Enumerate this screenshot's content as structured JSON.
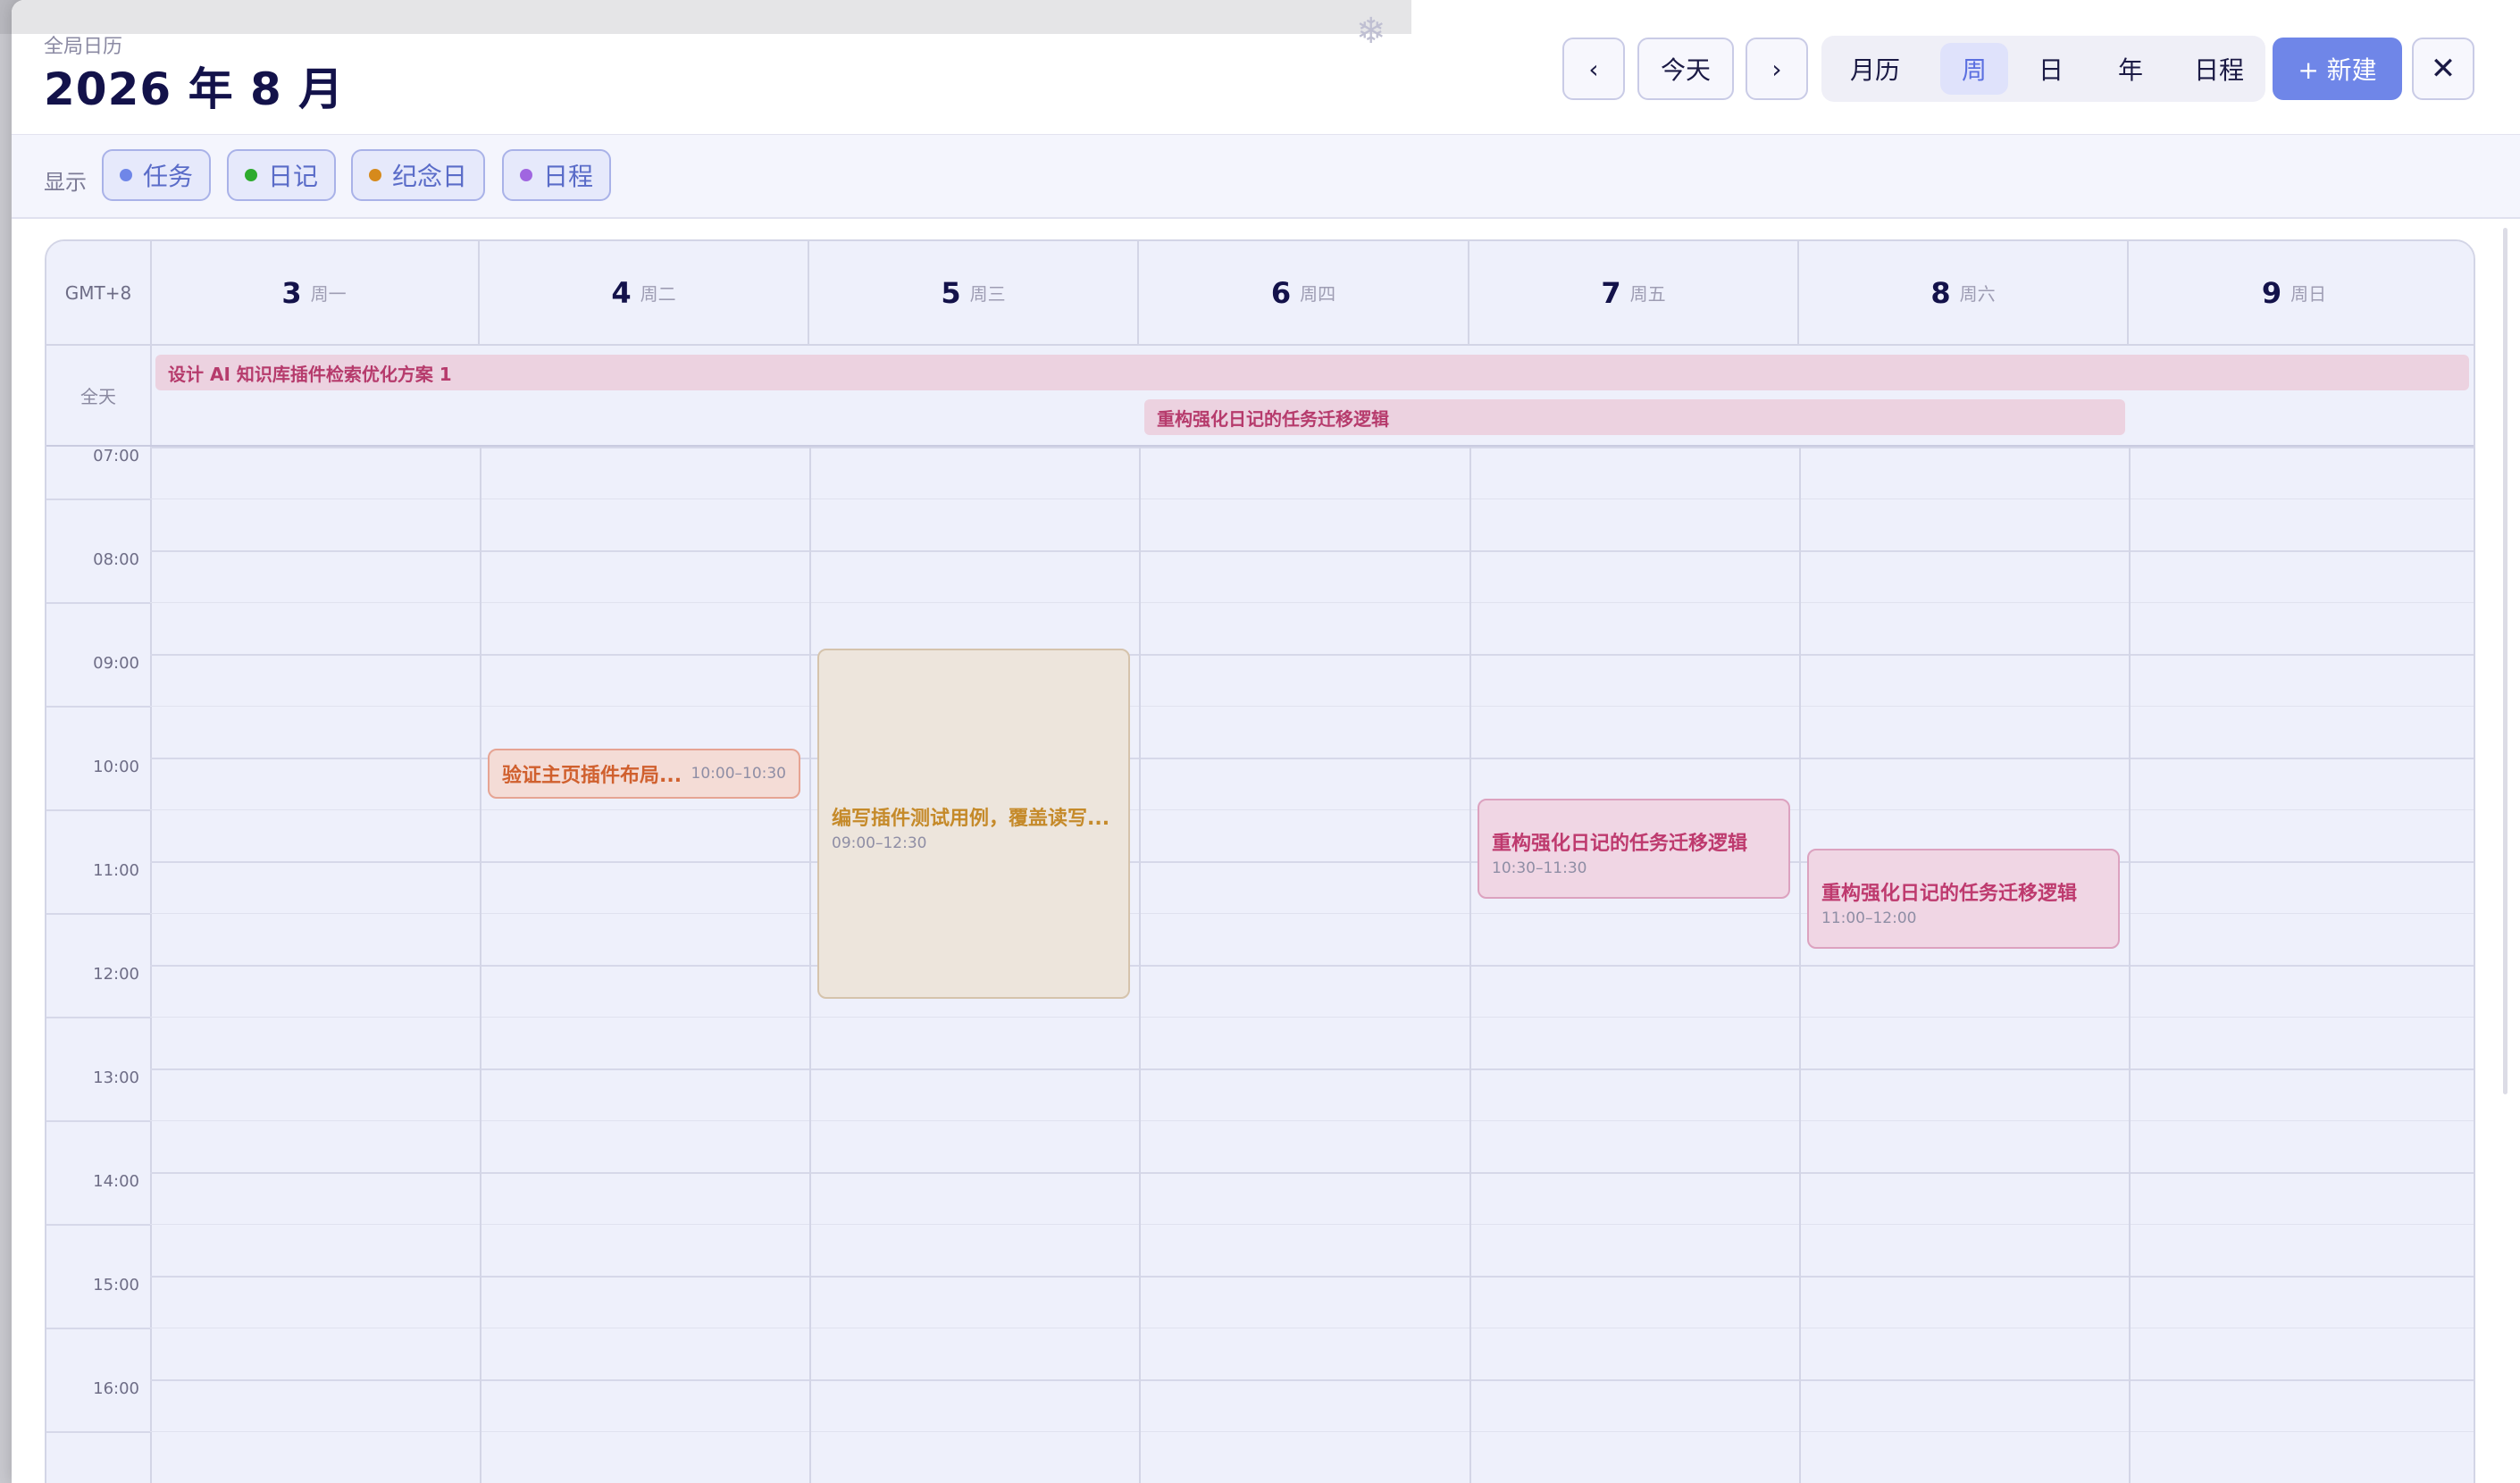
{
  "header": {
    "subtitle": "全局日历",
    "title": "2026 年 8 月",
    "today_label": "今天",
    "views": [
      "月历",
      "周",
      "日",
      "年",
      "日程"
    ],
    "active_view": "周",
    "new_label": "+ 新建"
  },
  "filters": {
    "label": "显示",
    "chips": [
      {
        "label": "任务",
        "color": "#6f86e8"
      },
      {
        "label": "日记",
        "color": "#2eab2e"
      },
      {
        "label": "纪念日",
        "color": "#d68a1c"
      },
      {
        "label": "日程",
        "color": "#a066e0"
      }
    ]
  },
  "calendar": {
    "timezone": "GMT+8",
    "allday_label": "全天",
    "days": [
      {
        "num": "3",
        "weekday": "周一"
      },
      {
        "num": "4",
        "weekday": "周二"
      },
      {
        "num": "5",
        "weekday": "周三"
      },
      {
        "num": "6",
        "weekday": "周四"
      },
      {
        "num": "7",
        "weekday": "周五"
      },
      {
        "num": "8",
        "weekday": "周六"
      },
      {
        "num": "9",
        "weekday": "周日"
      }
    ],
    "hours": [
      "07:00",
      "08:00",
      "09:00",
      "10:00",
      "11:00",
      "12:00",
      "13:00",
      "14:00",
      "15:00",
      "16:00"
    ],
    "allday_events": [
      {
        "title": "设计 AI 知识库插件检索优化方案 1"
      },
      {
        "title": "重构强化日记的任务迁移逻辑"
      }
    ],
    "events": [
      {
        "title": "验证主页插件布局...",
        "time": "10:00–10:30"
      },
      {
        "title": "编写插件测试用例，覆盖读写...",
        "time": "09:00–12:30"
      },
      {
        "title": "重构强化日记的任务迁移逻辑",
        "time": "10:30–11:30"
      },
      {
        "title": "重构强化日记的任务迁移逻辑",
        "time": "11:00–12:00"
      }
    ]
  }
}
